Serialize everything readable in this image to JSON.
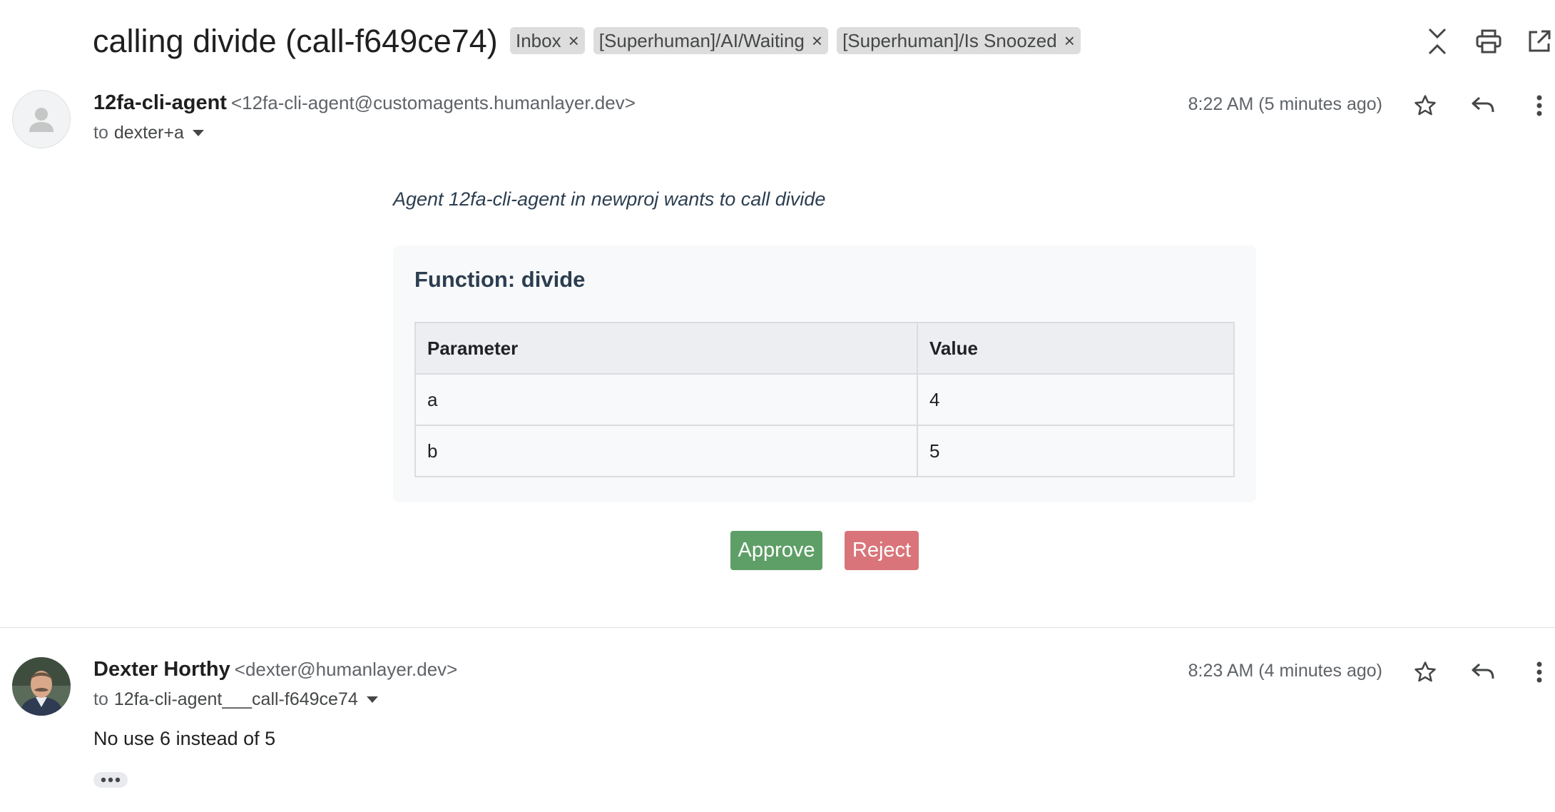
{
  "thread": {
    "subject": "calling divide (call-f649ce74)",
    "labels": [
      {
        "name": "Inbox"
      },
      {
        "name": "[Superhuman]/AI/Waiting"
      },
      {
        "name": "[Superhuman]/Is Snoozed"
      }
    ],
    "toolbar_icons": [
      "collapse-all-icon",
      "print-icon",
      "open-in-new-window-icon"
    ]
  },
  "messages": [
    {
      "sender_name": "12fa-cli-agent",
      "sender_email": "<12fa-cli-agent@customagents.humanlayer.dev>",
      "to_prefix": "to",
      "to": "dexter+a",
      "timestamp": "8:22 AM (5 minutes ago)",
      "intro": "Agent 12fa-cli-agent in newproj wants to call divide",
      "function_title": "Function: divide",
      "table": {
        "headers": [
          "Parameter",
          "Value"
        ],
        "rows": [
          [
            "a",
            "4"
          ],
          [
            "b",
            "5"
          ]
        ]
      },
      "approve_label": "Approve",
      "reject_label": "Reject",
      "approve_color": "#5e9f67",
      "reject_color": "#d9757a"
    },
    {
      "sender_name": "Dexter Horthy",
      "sender_email": "<dexter@humanlayer.dev>",
      "to_prefix": "to",
      "to": "12fa-cli-agent___call-f649ce74",
      "timestamp": "8:23 AM (4 minutes ago)",
      "body": "No use 6 instead of 5"
    }
  ]
}
